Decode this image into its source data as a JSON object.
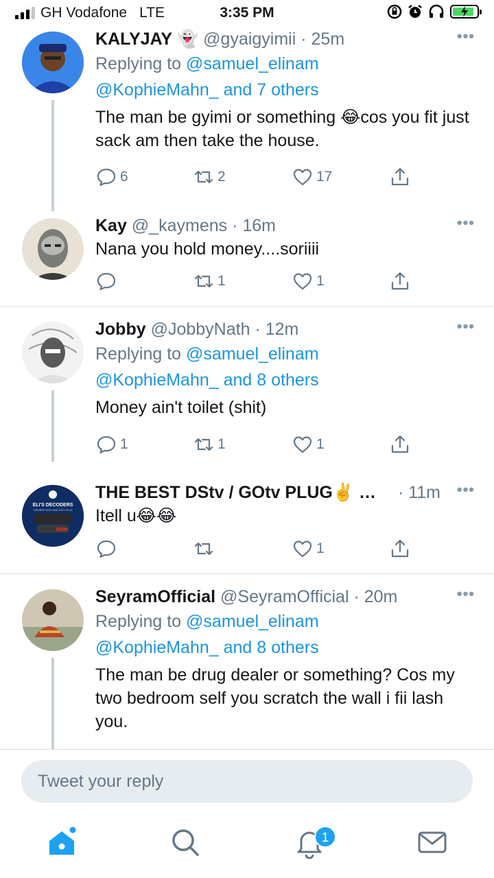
{
  "status_bar": {
    "carrier": "GH Vodafone",
    "network": "LTE",
    "time": "3:35 PM"
  },
  "tweets": [
    {
      "name": "KALYJAY",
      "name_emoji": "👻",
      "handle": "@gyaigyimii",
      "time": "25m",
      "replying_label": "Replying to",
      "replying_user": "@samuel_elinam",
      "replying_others": "@KophieMahn_ and 7 others",
      "text": "The man be gyimi or something 😂cos you fit just sack am then take the house.",
      "replies": "6",
      "retweets": "2",
      "likes": "17"
    },
    {
      "name": "Kay",
      "handle": "@_kaymens",
      "time": "16m",
      "text": "Nana you hold money....soriiii",
      "replies": "",
      "retweets": "1",
      "likes": "1"
    },
    {
      "name": "Jobby",
      "handle": "@JobbyNath",
      "time": "12m",
      "replying_label": "Replying to",
      "replying_user": "@samuel_elinam",
      "replying_others": "@KophieMahn_ and 8 others",
      "text": "Money ain't toilet (shit)",
      "replies": "1",
      "retweets": "1",
      "likes": "1"
    },
    {
      "name": "THE BEST DStv / GOtv PLUG",
      "name_emoji": "✌️ …",
      "handle": "",
      "time": "11m",
      "text": "Itell u😂😂",
      "replies": "",
      "retweets": "",
      "likes": "1",
      "avatar_title": "ELI'S DECODERS",
      "avatar_subtitle": "THE BEST DSTV AND GOTV PLUG",
      "avatar_brand": "GOtv"
    },
    {
      "name": "SeyramOfficial",
      "handle": "@SeyramOfficial",
      "time": "20m",
      "replying_label": "Replying to",
      "replying_user": "@samuel_elinam",
      "replying_others": "@KophieMahn_ and 8 others",
      "text": "The man be drug dealer or something? Cos my two bedroom self you scratch the wall i fii lash you."
    }
  ],
  "composer": {
    "placeholder": "Tweet your reply"
  },
  "tabbar": {
    "notifications_badge": "1"
  },
  "colors": {
    "accent": "#1da1f2",
    "link": "#1b95e0",
    "muted": "#657786",
    "thread_line": "#c4cfd6"
  },
  "icons": [
    "reply-icon",
    "retweet-icon",
    "like-icon",
    "share-icon",
    "more-icon",
    "home-icon",
    "search-icon",
    "notifications-icon",
    "messages-icon"
  ]
}
